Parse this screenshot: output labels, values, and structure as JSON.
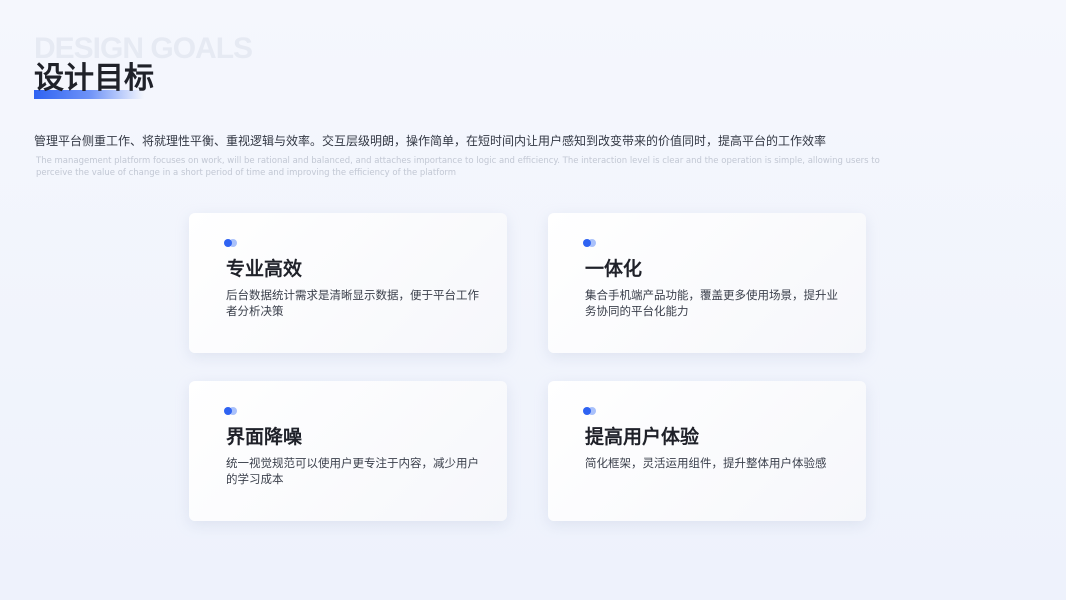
{
  "header": {
    "bg_title": "DESIGN GOALS",
    "title": "设计目标",
    "description": "管理平台侧重工作、将就理性平衡、重视逻辑与效率。交互层级明朗，操作简单，在短时间内让用户感知到改变带来的价值同时，提高平台的工作效率",
    "description_en": "The management platform focuses on work, will be rational and balanced, and attaches importance to logic and efficiency. The interaction level is clear and the operation is simple, allowing users to perceive the value of change in a short period of time and improving the efficiency of the platform"
  },
  "cards": [
    {
      "title": "专业高效",
      "text": "后台数据统计需求是清晰显示数据，便于平台工作者分析决策"
    },
    {
      "title": "一体化",
      "text": "集合手机端产品功能，覆盖更多使用场景，提升业务协同的平台化能力"
    },
    {
      "title": "界面降噪",
      "text": "统一视觉规范可以使用户更专注于内容，减少用户的学习成本"
    },
    {
      "title": "提高用户体验",
      "text": "简化框架，灵活运用组件，提升整体用户体验感"
    }
  ],
  "colors": {
    "accent": "#2f63f2",
    "accent_light": "#a9c1fb",
    "background": "#f2f5fd"
  }
}
